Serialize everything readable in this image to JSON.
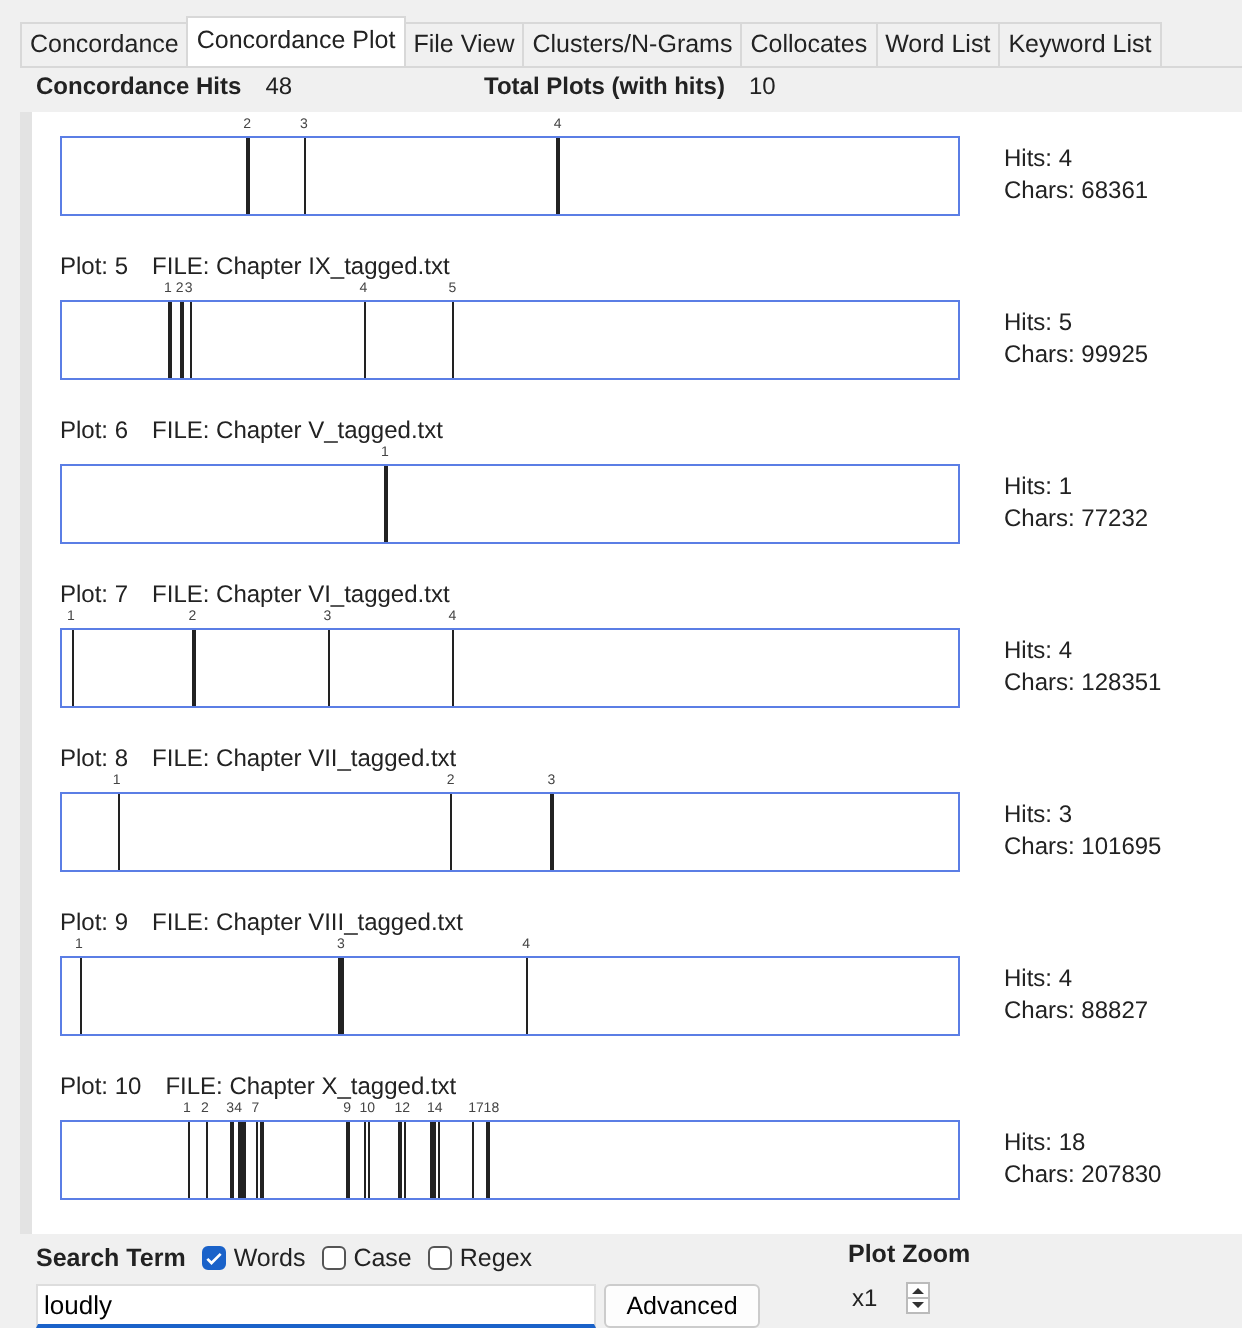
{
  "tabs": [
    {
      "label": "Concordance",
      "selected": false
    },
    {
      "label": "Concordance Plot",
      "selected": true
    },
    {
      "label": "File View",
      "selected": false
    },
    {
      "label": "Clusters/N-Grams",
      "selected": false
    },
    {
      "label": "Collocates",
      "selected": false
    },
    {
      "label": "Word List",
      "selected": false
    },
    {
      "label": "Keyword List",
      "selected": false
    }
  ],
  "stats": [
    {
      "label": "Concordance Hits",
      "value": "48"
    },
    {
      "label": "Total Plots (with hits)",
      "value": "10"
    }
  ],
  "plots": [
    {
      "hits_text": "Hits: 4",
      "chars_text": "Chars: 68361",
      "hits": [
        {
          "level": 0.205
        },
        {
          "label": "2",
          "level": 0.207
        },
        {
          "label": "3",
          "level": 0.27
        },
        {
          "label": "4",
          "level": 0.552
        }
      ]
    },
    {
      "plot": "Plot: 5",
      "file": "FILE: Chapter IX_tagged.txt",
      "hits_text": "Hits: 5",
      "chars_text": "Chars: 99925",
      "hits": [
        {
          "label": "1",
          "level": 0.119
        },
        {
          "label": "2",
          "level": 0.132
        },
        {
          "label": "3",
          "level": 0.142
        },
        {
          "label": "4",
          "level": 0.336
        },
        {
          "label": "5",
          "level": 0.435
        }
      ]
    },
    {
      "plot": "Plot: 6",
      "file": "FILE: Chapter V_tagged.txt",
      "hits_text": "Hits: 1",
      "chars_text": "Chars: 77232",
      "hits": [
        {
          "label": "1",
          "level": 0.36
        }
      ]
    },
    {
      "plot": "Plot: 7",
      "file": "FILE: Chapter VI_tagged.txt",
      "hits_text": "Hits: 4",
      "chars_text": "Chars: 128351",
      "hits": [
        {
          "label": "1",
          "level": 0.011
        },
        {
          "label": "2",
          "level": 0.146
        },
        {
          "label": "3",
          "level": 0.296
        },
        {
          "label": "4",
          "level": 0.435
        }
      ]
    },
    {
      "plot": "Plot: 8",
      "file": "FILE: Chapter VII_tagged.txt",
      "hits_text": "Hits: 3",
      "chars_text": "Chars: 101695",
      "hits": [
        {
          "label": "1",
          "level": 0.062
        },
        {
          "label": "2",
          "level": 0.433
        },
        {
          "label": "3",
          "level": 0.545
        }
      ]
    },
    {
      "plot": "Plot: 9",
      "file": "FILE: Chapter VIII_tagged.txt",
      "hits_text": "Hits: 4",
      "chars_text": "Chars: 88827",
      "hits": [
        {
          "label": "1",
          "level": 0.02
        },
        {
          "level": 0.309
        },
        {
          "label": "3",
          "level": 0.311
        },
        {
          "label": "4",
          "level": 0.517
        }
      ]
    },
    {
      "plot": "Plot: 10",
      "file": "FILE: Chapter X_tagged.txt",
      "hits_text": "Hits: 18",
      "chars_text": "Chars: 207830",
      "hits": [
        {
          "label": "1",
          "level": 0.14
        },
        {
          "label": "2",
          "level": 0.16
        },
        {
          "label": "3",
          "level": 0.188
        },
        {
          "label": "4",
          "level": 0.197
        },
        {
          "level": 0.199
        },
        {
          "level": 0.201
        },
        {
          "label": "7",
          "level": 0.216
        },
        {
          "level": 0.222
        },
        {
          "label": "9",
          "level": 0.318
        },
        {
          "label": "10",
          "level": 0.336
        },
        {
          "level": 0.341
        },
        {
          "label": "12",
          "level": 0.375
        },
        {
          "level": 0.381
        },
        {
          "label": "14",
          "level": 0.411
        },
        {
          "level": 0.414
        },
        {
          "level": 0.419
        },
        {
          "label": "17",
          "level": 0.457
        },
        {
          "label": "18",
          "level": 0.474
        }
      ]
    }
  ],
  "search": {
    "label": "Search Term",
    "options": [
      {
        "label": "Words",
        "checked": true
      },
      {
        "label": "Case",
        "checked": false
      },
      {
        "label": "Regex",
        "checked": false
      }
    ],
    "value": "loudly",
    "button": "Advanced"
  },
  "zoom": {
    "label": "Plot Zoom",
    "value": "x1"
  }
}
